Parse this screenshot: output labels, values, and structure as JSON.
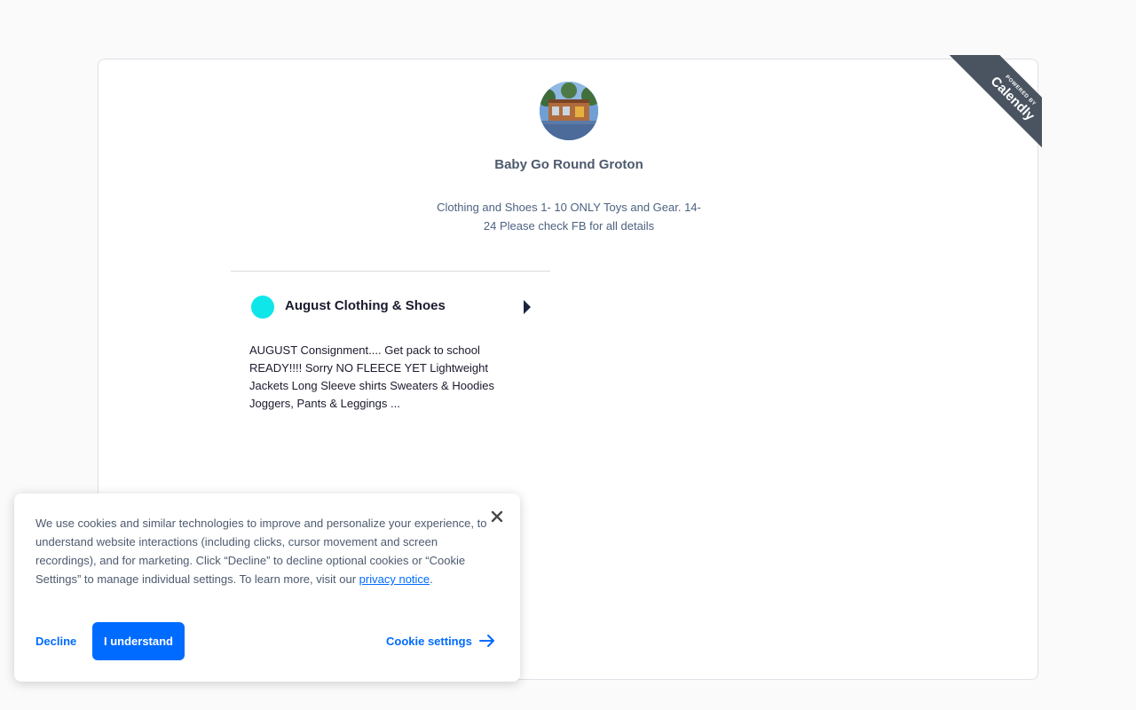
{
  "ribbon": {
    "small": "POWERED BY",
    "big": "Calendly"
  },
  "org": {
    "name": "Baby Go Round Groton",
    "description": "Clothing and Shoes 1- 10 ONLY Toys and Gear. 14-24 Please check FB for all details"
  },
  "event": {
    "title": "August Clothing & Shoes",
    "color": "#0fe6ea",
    "description": "AUGUST Consignment.... Get pack to school READY!!!! Sorry NO FLEECE YET Lightweight Jackets Long Sleeve shirts Sweaters & Hoodies Joggers, Pants & Leggings ..."
  },
  "cookie": {
    "text": "We use cookies and similar technologies to improve and personalize your experience, to understand website interactions (including clicks, cursor movement and screen recordings), and for marketing. Click “Decline” to decline optional cookies or “Cookie Settings” to manage individual settings. To learn more, visit our ",
    "link": "privacy notice",
    "after_link": ".",
    "decline_label": "Decline",
    "accept_label": "I understand",
    "settings_label": "Cookie settings"
  },
  "colors": {
    "accent": "#006bff",
    "ribbon": "#4a5460"
  }
}
